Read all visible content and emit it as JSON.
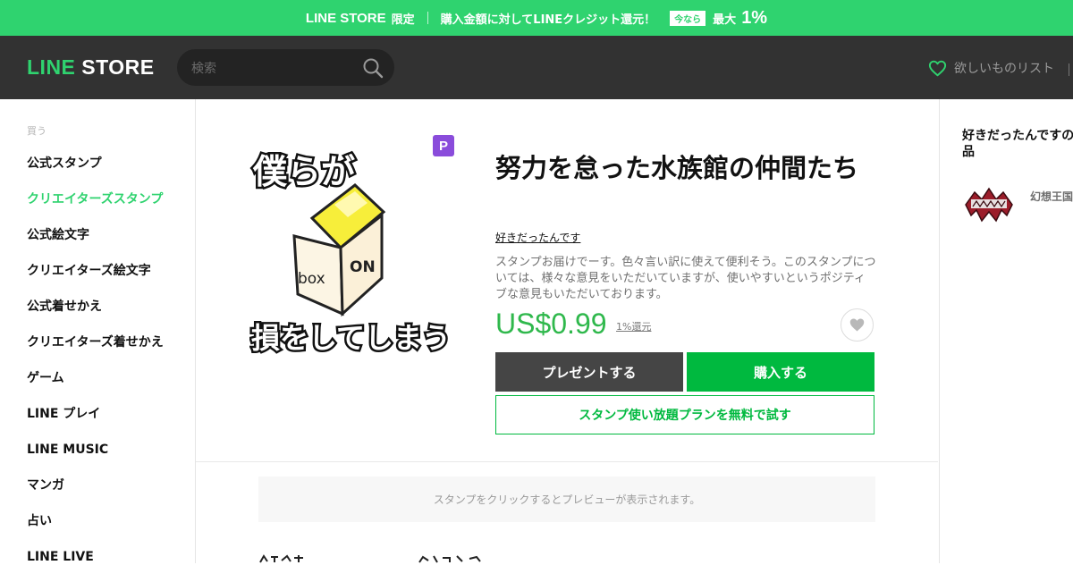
{
  "promo": {
    "brand": "LINE STORE",
    "limited": "限定",
    "message": "購入金額に対してLINEクレジット還元！",
    "badge": "今なら",
    "max_label": "最大",
    "percent": "1%"
  },
  "header": {
    "logo_line": "LINE",
    "logo_store": "STORE",
    "search_placeholder": "検索",
    "wishlist_label": "欲しいものリスト"
  },
  "sidebar": {
    "section_label": "買う",
    "items": [
      {
        "label": "公式スタンプ",
        "active": false
      },
      {
        "label": "クリエイターズスタンプ",
        "active": true
      },
      {
        "label": "公式絵文字",
        "active": false
      },
      {
        "label": "クリエイターズ絵文字",
        "active": false
      },
      {
        "label": "公式着せかえ",
        "active": false
      },
      {
        "label": "クリエイターズ着せかえ",
        "active": false
      },
      {
        "label": "ゲーム",
        "active": false
      },
      {
        "label": "LINE プレイ",
        "active": false
      },
      {
        "label": "LINE MUSIC",
        "active": false
      },
      {
        "label": "マンガ",
        "active": false
      },
      {
        "label": "占い",
        "active": false
      },
      {
        "label": "LINE LIVE",
        "active": false
      }
    ]
  },
  "product": {
    "image_text_top": "僕らが",
    "image_text_box_1": "box",
    "image_text_box_2": "ON",
    "image_text_bottom": "損をしてしまう",
    "premium_badge": "P",
    "title": "努力を怠った水族館の仲間たち",
    "author": "好きだったんです",
    "description": "スタンプお届けでーす。色々言い訳に使えて便利そう。このスタンプについては、様々な意見をいただいていますが、使いやすいというポジティブな意見もいただいております。",
    "price": "US$0.99",
    "cashback": "1%還元",
    "present_button": "プレゼントする",
    "buy_button": "購入する",
    "trial_button": "スタンプ使い放題プランを無料で試す"
  },
  "preview_note": "スタンプをクリックするとプレビューが表示されます。",
  "author_works": {
    "title": "好きだったんですの作品",
    "items": [
      {
        "name": "幻想王国ち"
      }
    ]
  },
  "colors": {
    "brand_green": "#2fd36f",
    "header_dark": "#323232",
    "buy_green": "#00b93f",
    "price_green": "#2fb84c",
    "premium_purple": "#8a4cdb"
  },
  "icons": [
    "search-icon",
    "heart-outline-icon",
    "heart-filled-icon"
  ]
}
